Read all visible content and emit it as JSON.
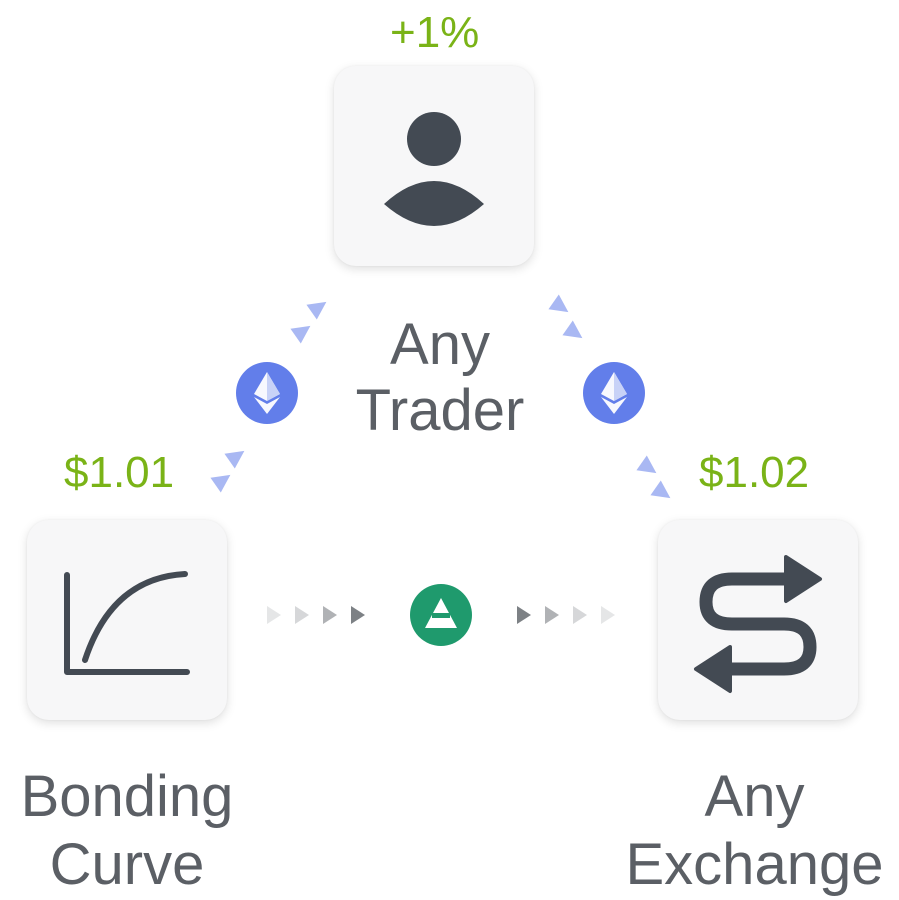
{
  "trader": {
    "fee": "+1%",
    "label_line1": "Any",
    "label_line2": "Trader",
    "icon": "person-icon"
  },
  "bonding_curve": {
    "price": "$1.01",
    "label_line1": "Bonding",
    "label_line2": "Curve",
    "icon": "curve-chart-icon"
  },
  "exchange": {
    "price": "$1.02",
    "label_line1": "Any",
    "label_line2": "Exchange",
    "icon": "swap-arrows-icon"
  },
  "tokens": {
    "left": "ethereum-icon",
    "right": "ethereum-icon",
    "bottom": "pyramid-token-icon"
  },
  "colors": {
    "price_green": "#7ab317",
    "label_gray": "#5b5f65",
    "icon_dark": "#434a53",
    "eth_blue": "#627eea",
    "token_green": "#1f9a6d",
    "flow_arrow_blue": "#a9b8f3",
    "flow_arrow_gray": "#b5b7ba"
  }
}
